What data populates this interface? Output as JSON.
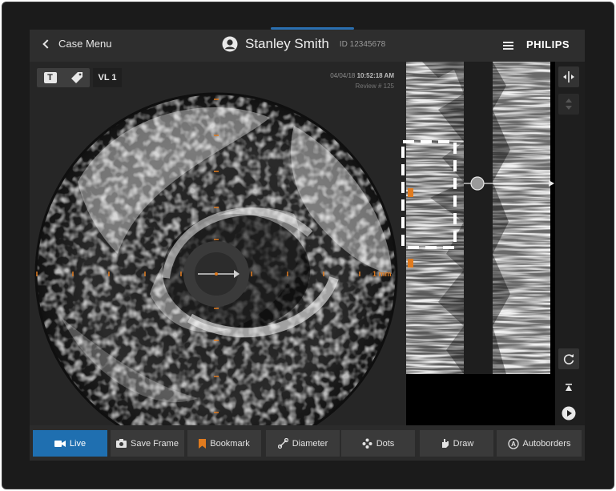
{
  "header": {
    "back_label": "Case Menu",
    "patient_name": "Stanley Smith",
    "patient_id": "ID 12345678",
    "brand": "PHILIPS"
  },
  "ivus": {
    "tool_text_icon": "T",
    "vessel_label": "VL 1",
    "date": "04/04/18",
    "time": "10:52:18 AM",
    "review": "Review # 125",
    "scale_label": "1 mm"
  },
  "toolbar": {
    "live": "Live",
    "save_frame": "Save Frame",
    "bookmark": "Bookmark",
    "diameter": "Diameter",
    "dots": "Dots",
    "draw": "Draw",
    "autoborders": "Autoborders"
  },
  "colors": {
    "accent_blue": "#1f6fb0",
    "marker_orange": "#e07b1f",
    "highlight_dash": "#ffffff"
  },
  "icons": [
    "back-chevron-icon",
    "user-avatar-icon",
    "hamburger-menu-icon",
    "text-tool-icon",
    "tag-icon",
    "crosshair-icon",
    "sort-arrows-icon",
    "refresh-icon",
    "skip-top-icon",
    "play-icon",
    "skip-bottom-icon",
    "video-camera-icon",
    "camera-icon",
    "bookmark-icon",
    "diameter-icon",
    "dots-icon",
    "draw-hand-icon",
    "autoborders-icon"
  ]
}
